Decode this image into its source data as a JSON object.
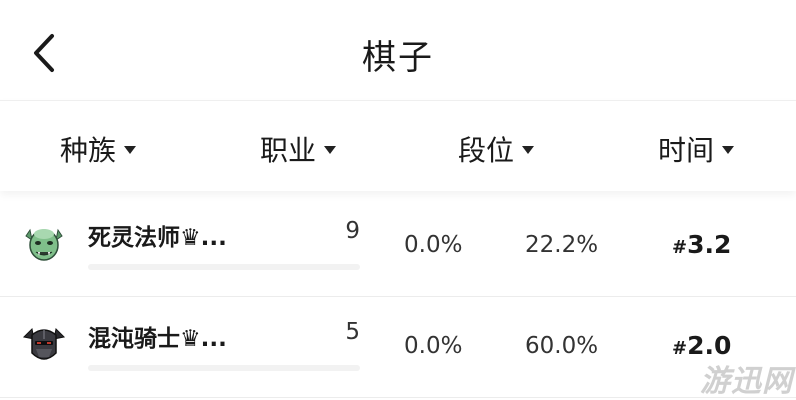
{
  "header": {
    "title": "棋子",
    "back_icon": "chevron-left-icon"
  },
  "filters": [
    {
      "label": "种族",
      "icon": "caret-down-icon"
    },
    {
      "label": "职业",
      "icon": "caret-down-icon"
    },
    {
      "label": "段位",
      "icon": "caret-down-icon"
    },
    {
      "label": "时间",
      "icon": "caret-down-icon"
    }
  ],
  "rows": [
    {
      "name": "死灵法师♛...",
      "count": "9",
      "pct1": "0.0%",
      "pct2": "22.2%",
      "rank_prefix": "#",
      "rank_value": "3.2",
      "avatar_icon": "green-orc-head-icon"
    },
    {
      "name": "混沌骑士♛...",
      "count": "5",
      "pct1": "0.0%",
      "pct2": "60.0%",
      "rank_prefix": "#",
      "rank_value": "2.0",
      "avatar_icon": "dark-armored-knight-icon"
    }
  ],
  "watermark": "游迅网"
}
